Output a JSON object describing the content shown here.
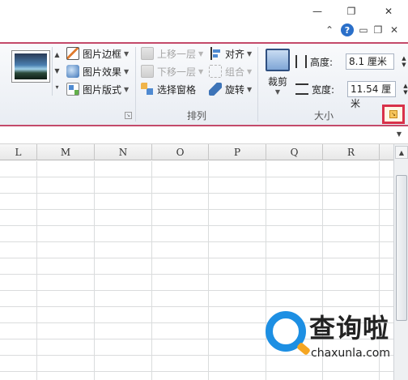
{
  "window": {
    "minimize_glyph": "—",
    "restore_glyph": "❐",
    "close_glyph": "✕",
    "help_glyph": "?",
    "collapse_glyph": "⌃",
    "sub_min_glyph": "▭",
    "sub_restore_glyph": "❐",
    "sub_close_glyph": "✕"
  },
  "ribbon": {
    "picture_styles": {
      "border_label": "图片边框",
      "effects_label": "图片效果",
      "layout_label": "图片版式"
    },
    "arrange": {
      "bring_forward_label": "上移一层",
      "send_backward_label": "下移一层",
      "selection_pane_label": "选择窗格",
      "align_label": "对齐",
      "group_label": "组合",
      "rotate_label": "旋转",
      "group_title": "排列"
    },
    "size": {
      "crop_label": "裁剪",
      "height_label": "高度:",
      "height_value": "8.1 厘米",
      "width_label": "宽度:",
      "width_value": "11.54 厘米",
      "group_title": "大小"
    },
    "accent_color": "#d8314a"
  },
  "sheet": {
    "columns": [
      "L",
      "M",
      "N",
      "O",
      "P",
      "Q",
      "R"
    ]
  },
  "watermark": {
    "brand_text": "查询啦",
    "url_text": "chaxunla.com"
  }
}
